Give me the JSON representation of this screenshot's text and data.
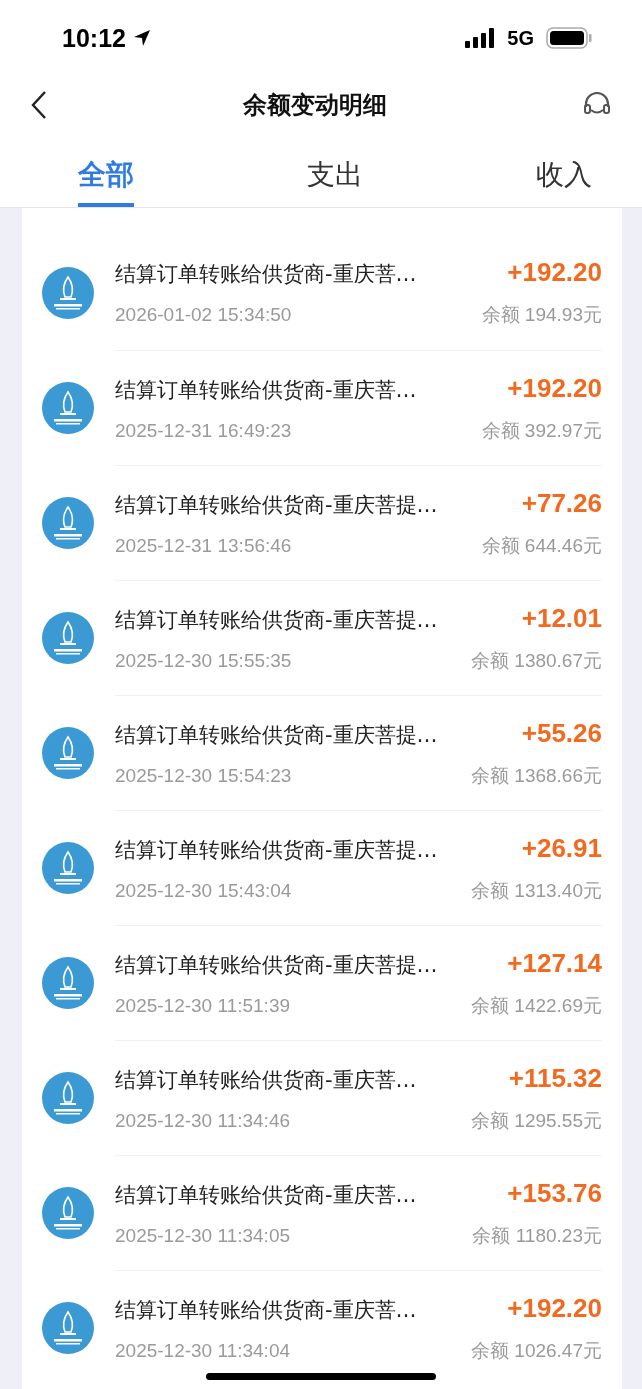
{
  "status_bar": {
    "time": "10:12",
    "network": "5G"
  },
  "header": {
    "title": "余额变动明细"
  },
  "tabs": [
    {
      "label": "全部",
      "selected": true
    },
    {
      "label": "支出",
      "selected": false
    },
    {
      "label": "收入",
      "selected": false
    }
  ],
  "records": [
    {
      "title": "结算订单转账给供货商-重庆菩…",
      "amount": "+192.20",
      "time": "2026-01-02 15:34:50",
      "balance": "余额 194.93元"
    },
    {
      "title": "结算订单转账给供货商-重庆菩…",
      "amount": "+192.20",
      "time": "2025-12-31 16:49:23",
      "balance": "余额 392.97元"
    },
    {
      "title": "结算订单转账给供货商-重庆菩提…",
      "amount": "+77.26",
      "time": "2025-12-31 13:56:46",
      "balance": "余额 644.46元"
    },
    {
      "title": "结算订单转账给供货商-重庆菩提…",
      "amount": "+12.01",
      "time": "2025-12-30 15:55:35",
      "balance": "余额 1380.67元"
    },
    {
      "title": "结算订单转账给供货商-重庆菩提…",
      "amount": "+55.26",
      "time": "2025-12-30 15:54:23",
      "balance": "余额 1368.66元"
    },
    {
      "title": "结算订单转账给供货商-重庆菩提…",
      "amount": "+26.91",
      "time": "2025-12-30 15:43:04",
      "balance": "余额 1313.40元"
    },
    {
      "title": "结算订单转账给供货商-重庆菩提…",
      "amount": "+127.14",
      "time": "2025-12-30 11:51:39",
      "balance": "余额 1422.69元"
    },
    {
      "title": "结算订单转账给供货商-重庆菩…",
      "amount": "+115.32",
      "time": "2025-12-30 11:34:46",
      "balance": "余额 1295.55元"
    },
    {
      "title": "结算订单转账给供货商-重庆菩…",
      "amount": "+153.76",
      "time": "2025-12-30 11:34:05",
      "balance": "余额 1180.23元"
    },
    {
      "title": "结算订单转账给供货商-重庆菩…",
      "amount": "+192.20",
      "time": "2025-12-30 11:34:04",
      "balance": "余额 1026.47元"
    }
  ]
}
